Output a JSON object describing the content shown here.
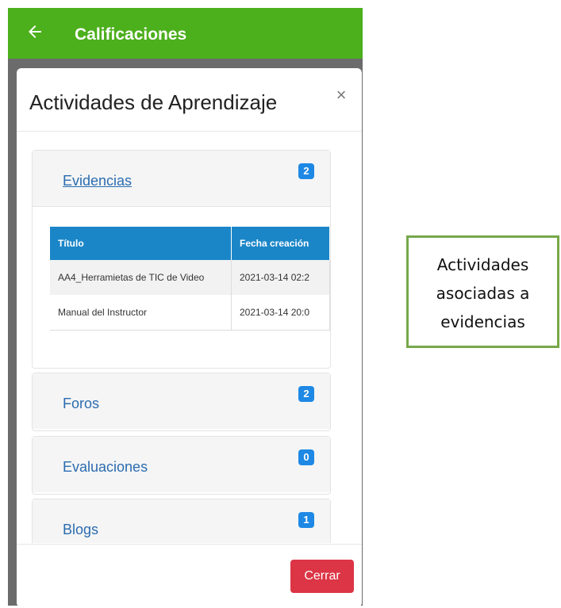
{
  "appbar": {
    "title": "Calificaciones",
    "back_icon": "arrow-left-icon"
  },
  "modal": {
    "title": "Actividades de Aprendizaje",
    "close_symbol": "×",
    "panels": [
      {
        "label": "Evidencias",
        "count": "2",
        "expanded": true
      },
      {
        "label": "Foros",
        "count": "2"
      },
      {
        "label": "Evaluaciones",
        "count": "0"
      },
      {
        "label": "Blogs",
        "count": "1"
      }
    ],
    "table": {
      "headers": [
        "Título",
        "Fecha creación"
      ],
      "rows": [
        [
          "AA4_Herramietas de TIC de Video",
          "2021-03-14 02:2"
        ],
        [
          "Manual del Instructor",
          "2021-03-14 20:0"
        ]
      ]
    },
    "footer": {
      "close_label": "Cerrar"
    }
  },
  "callout": {
    "line1": "Actividades",
    "line2": "asociadas a",
    "line3": "evidencias"
  },
  "colors": {
    "appbar": "#4caf1c",
    "badge": "#1e88e5",
    "table_header": "#1a86c8",
    "close_button": "#dc3545",
    "callout_border": "#76a84a"
  }
}
